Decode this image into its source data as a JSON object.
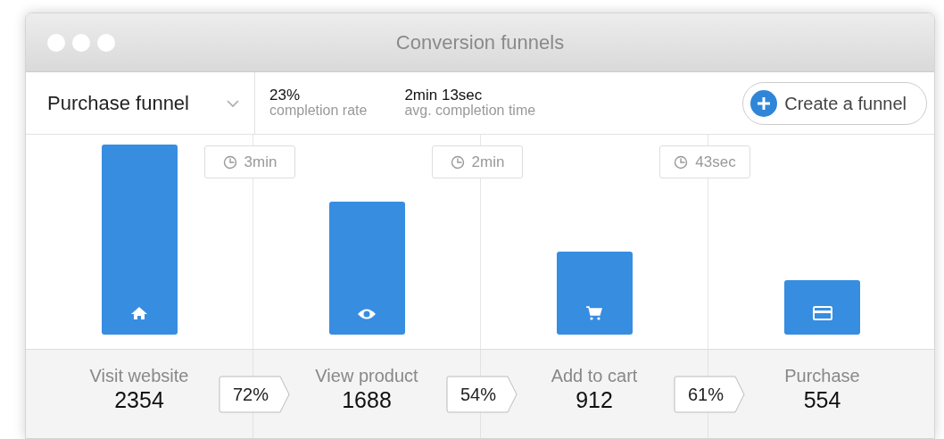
{
  "window": {
    "title": "Conversion funnels"
  },
  "toolbar": {
    "funnel_select": "Purchase funnel",
    "stats": [
      {
        "value": "23%",
        "label": "completion rate"
      },
      {
        "value": "2min 13sec",
        "label": "avg. completion time"
      }
    ],
    "create_button": "Create a funnel"
  },
  "steps": [
    {
      "name": "Visit website",
      "count": "2354"
    },
    {
      "name": "View product",
      "count": "1688"
    },
    {
      "name": "Add to cart",
      "count": "912"
    },
    {
      "name": "Purchase",
      "count": "554"
    }
  ],
  "transitions": [
    {
      "time": "3min",
      "rate": "72%"
    },
    {
      "time": "2min",
      "rate": "54%"
    },
    {
      "time": "43sec",
      "rate": "61%"
    }
  ]
}
